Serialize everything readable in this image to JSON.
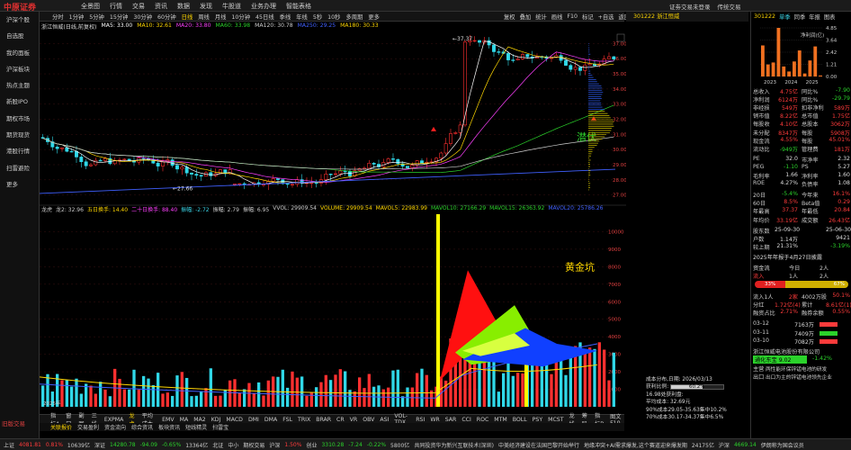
{
  "app": {
    "logo": "中原证券",
    "menu": [
      "全景图",
      "行情",
      "交易",
      "资讯",
      "数据",
      "发现",
      "牛股道",
      "业务办理",
      "智能表格"
    ],
    "top_right": [
      "证劵交易未登录",
      "传统交易"
    ],
    "window_code": "301222",
    "window_name": "浙江恒威"
  },
  "left_nav": {
    "items": [
      "沪深个股",
      "自选股",
      "我的面板",
      "沪深板块",
      "热点主题",
      "新股IPO",
      "期权市场",
      "期货现货",
      "港股行情",
      "扫雷避险",
      "更多"
    ],
    "bottom": "旧版交易"
  },
  "period_bar": {
    "items": [
      "分时",
      "1分钟",
      "5分钟",
      "15分钟",
      "30分钟",
      "60分钟",
      "日线",
      "周线",
      "月线",
      "10分钟",
      "45日线",
      "季线",
      "年线",
      "5秒",
      "10秒",
      "多周期",
      "更多"
    ],
    "active": "日线",
    "tools": [
      "复权",
      "叠加",
      "统计",
      "画线",
      "F10",
      "标记",
      "+自选",
      "返回"
    ]
  },
  "chart_title": "浙江恒威(日线,前复权)",
  "ma_legend": [
    {
      "label": "MA5: 33.00",
      "color": "#ffffff"
    },
    {
      "label": "MA10: 32.61",
      "color": "#ffd700"
    },
    {
      "label": "MA20: 33.80",
      "color": "#ff40ff"
    },
    {
      "label": "MA60: 33.98",
      "color": "#2bd22b"
    },
    {
      "label": "MA120: 30.78",
      "color": "#cfcfcf"
    },
    {
      "label": "MA250: 29.25",
      "color": "#4060ff"
    },
    {
      "label": "MA180: 30.33",
      "color": "#ffd700"
    }
  ],
  "price_axis": [
    "37.00",
    "36.00",
    "35.00",
    "34.00",
    "33.00",
    "32.00",
    "31.00",
    "30.00",
    "29.00",
    "28.00",
    "27.00"
  ],
  "annotations": {
    "high": "37.37",
    "low": "27.66",
    "qianfu": "潜伏",
    "huangjinkeng": "黄金坑",
    "date_start": "2025年"
  },
  "indicator_legend": [
    {
      "label": "龙虎",
      "color": "#ccc"
    },
    {
      "label": "龙2: 32.96",
      "color": "#ccc"
    },
    {
      "label": "五日换手: 14.40",
      "color": "#ffd700"
    },
    {
      "label": "二十日换手: 88.40",
      "color": "#ff40ff"
    },
    {
      "label": "振幅: -2.72",
      "color": "#3bd6e8"
    },
    {
      "label": "振幅: 2.79",
      "color": "#ccc"
    },
    {
      "label": "振幅: 6.95",
      "color": "#ccc"
    },
    {
      "label": "VVOL: 29909.54",
      "color": "#ccc"
    },
    {
      "label": "VOLUME: 29909.54",
      "color": "#ffd700"
    },
    {
      "label": "MAVOL5: 22983.99",
      "color": "#ffd700"
    },
    {
      "label": "MAVOL10: 27166.29",
      "color": "#2bd22b"
    },
    {
      "label": "MAVOL15: 26363.92",
      "color": "#2bd22b"
    },
    {
      "label": "MAVOL20: 25786.26",
      "color": "#4060ff"
    }
  ],
  "volume_axis": [
    "10000",
    "9000",
    "8000",
    "7000",
    "6000",
    "5000",
    "4000",
    "3000",
    "2000",
    "1000"
  ],
  "indicator_tabs": [
    "指标A",
    "窗口",
    "副图",
    "三线",
    "EXPMA",
    "龙虎",
    "平均成本",
    "EMV",
    "MA",
    "MA2",
    "KDJ",
    "MACD",
    "DMI",
    "DMA",
    "FSL",
    "TRIX",
    "BRAR",
    "CR",
    "VR",
    "OBV",
    "ASI",
    "VOL-TDX",
    "RSI",
    "WR",
    "SAR",
    "CCI",
    "ROC",
    "MTM",
    "BOLL",
    "PSY",
    "MCST",
    "龙线",
    "筹码"
  ],
  "indicator_tabs_active": "龙虎",
  "indicator_tabs_right": [
    "指标B",
    "图文F10"
  ],
  "sub_tabs": [
    "关联报价",
    "交易盈利",
    "资金流向",
    "综合资讯",
    "板块资讯",
    "短线精灵",
    "扫雷宝"
  ],
  "sub_tabs_active": "关联报价",
  "cost_info": {
    "title": "成本分布,日期: 2026/03/13",
    "profit_label": "获利比例:",
    "profit_value": "60.2%",
    "line1": "16.98处获利盘:",
    "avg_cost": "平均成本: 32.69元",
    "range90": "90%成本29.05-35.63集中10.2%",
    "range70": "70%成本30.17-34.37集中6.5%"
  },
  "right_panel": {
    "code": "301222",
    "tabs": [
      "单季",
      "同季",
      "年报",
      "图表"
    ],
    "bar_chart": {
      "label": "净利润(亿)",
      "yaxis": [
        "4.85",
        "3.64",
        "2.42",
        "1.21",
        "0.00"
      ],
      "xaxis": [
        "2023",
        "2024",
        "2025"
      ],
      "values": [
        3.1,
        1.2,
        1.4,
        4.85,
        1.0,
        0.5,
        1.5,
        2.6,
        0.3,
        1.6,
        3.0,
        0.1
      ]
    },
    "fin_rows": [
      [
        "总收入",
        "4.75亿",
        "同比%",
        "-7.90"
      ],
      [
        "净利润",
        "6124万",
        "同比%",
        "-29.79"
      ],
      [
        "非经损",
        "549万",
        "扣非净利",
        "589万"
      ],
      [
        "销市值",
        "8.22亿",
        "总市值",
        "1.75亿"
      ],
      [
        "每股收",
        "4.10亿",
        "总股本",
        "3062万"
      ],
      [
        "未分配",
        "8347万",
        "每股",
        "5908万"
      ],
      [
        "现金流",
        "4.55%",
        "每股",
        "45.01%"
      ],
      [
        "流动比",
        "-949万",
        "管理费",
        "181万"
      ]
    ],
    "val_rows": [
      [
        "PE",
        "32.0",
        "市净率",
        "2.32"
      ],
      [
        "PEG",
        "-1.10",
        "PS",
        "5.27"
      ],
      [
        "毛利率",
        "1.66",
        "净利率",
        "1.60"
      ],
      [
        "ROE",
        "4.27%",
        "负债率",
        "1.08"
      ]
    ],
    "perf_rows": [
      [
        "20日",
        "-5.4%",
        "今年来",
        "16.1%"
      ],
      [
        "60日",
        "8.5%",
        "Beta值",
        "0.29"
      ],
      [
        "年最高",
        "37.37",
        "年最低",
        "20.84"
      ],
      [
        "年均价",
        "33.19亿",
        "成交额",
        "26.43亿"
      ]
    ],
    "holder_rows": [
      [
        "股东数",
        "25-09-30",
        "",
        "25-06-30"
      ],
      [
        "户数",
        "1.14万",
        "",
        "9421"
      ],
      [
        "较上期",
        "21.31%",
        "",
        "-3.19%"
      ]
    ],
    "notice": "2025年年报于4月27日披露",
    "flow_header": [
      "资金流",
      "今日",
      "2人"
    ],
    "flow_sub": [
      "流入",
      "1人",
      "2人"
    ],
    "flow_pct_left": "33%",
    "flow_pct_right": "67%",
    "north_rows": [
      [
        "流入1人",
        "2家",
        "4002万股",
        "50.1%"
      ],
      [
        "分红",
        "1.72亿(4)",
        "累计",
        "8.61亿(1)"
      ],
      [
        "融资占比",
        "2.71%",
        "融券余额",
        "0.55%"
      ]
    ],
    "dates": [
      [
        "03-12",
        "7163万"
      ],
      [
        "03-11",
        "7409万"
      ],
      [
        "03-10",
        "7082万"
      ]
    ],
    "concept_label": "浙江恒威电池股份有限公司",
    "tags": [
      "通化东宝 9.02",
      "-1.42%"
    ],
    "intro": [
      "主营",
      "两性能环保锌锰电池的研发",
      "出口",
      "出口为主的锌锰电池领先企业"
    ]
  },
  "status_bar": [
    {
      "t": "上证",
      "c": "#ccc"
    },
    {
      "t": "4081.81",
      "c": "#ff3b3b"
    },
    {
      "t": "0.81%",
      "c": "#ff3b3b"
    },
    {
      "t": "10639亿",
      "c": "#ccc"
    },
    {
      "t": "深证",
      "c": "#ccc"
    },
    {
      "t": "14280.78",
      "c": "#2bd22b"
    },
    {
      "t": "-94.09",
      "c": "#2bd22b"
    },
    {
      "t": "-0.65%",
      "c": "#2bd22b"
    },
    {
      "t": "13364亿",
      "c": "#ccc"
    },
    {
      "t": "北证",
      "c": "#ccc"
    },
    {
      "t": "中小",
      "c": "#ccc"
    },
    {
      "t": "期权交易",
      "c": "#ccc"
    },
    {
      "t": "沪深",
      "c": "#ccc"
    },
    {
      "t": "1.50%",
      "c": "#ff3b3b"
    },
    {
      "t": "创业",
      "c": "#ccc"
    },
    {
      "t": "3310.28",
      "c": "#2bd22b"
    },
    {
      "t": "-7.24",
      "c": "#2bd22b"
    },
    {
      "t": "-0.22%",
      "c": "#2bd22b"
    },
    {
      "t": "5800亿",
      "c": "#ccc"
    },
    {
      "t": "共同投资华为新兴互联技术(深圳)",
      "c": "#ccc"
    },
    {
      "t": "中美经济建设在法国巴黎开始举行",
      "c": "#ccc"
    },
    {
      "t": "地缘冲突+AI需求爆发,这个赛道迎来爆发期",
      "c": "#ccc"
    },
    {
      "t": "24175亿",
      "c": "#ccc"
    },
    {
      "t": "沪深",
      "c": "#ccc"
    },
    {
      "t": "4669.14",
      "c": "#2bd22b"
    },
    {
      "t": "伊朗称为国会议员",
      "c": "#ccc"
    }
  ]
}
